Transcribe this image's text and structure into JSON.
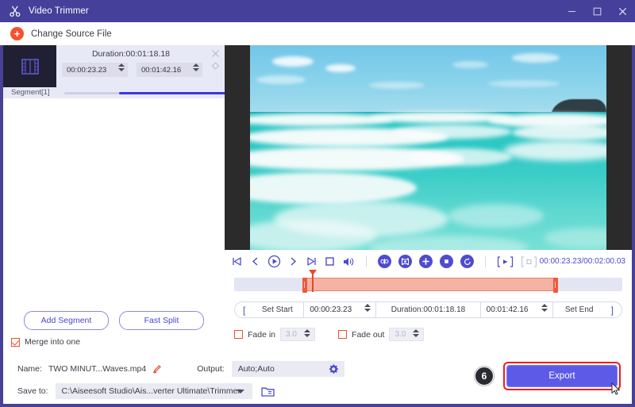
{
  "window": {
    "title": "Video Trimmer",
    "icon": "scissors-icon",
    "minimize": "minimize-icon",
    "maximize": "maximize-icon",
    "close": "close-icon"
  },
  "source_bar": {
    "add_icon": "plus-circle-icon",
    "label": "Change Source File"
  },
  "segment": {
    "thumb_icon": "film-strip-icon",
    "label": "Segment[1]",
    "duration_label": "Duration:00:01:18.18",
    "start_time": "00:00:23.23",
    "end_time": "00:01:42.16",
    "close_icon": "close-icon",
    "collapse_icon": "diamond-expand-icon",
    "progress_percent": 62
  },
  "left_actions": {
    "add_segment": "Add Segment",
    "fast_split": "Fast Split",
    "merge_label": "Merge into one",
    "merge_checked": true
  },
  "player": {
    "icons": [
      "skip-to-start-icon",
      "previous-frame-icon",
      "play-icon",
      "next-frame-icon",
      "skip-to-end-icon",
      "stop-icon",
      "volume-icon"
    ],
    "tools": [
      "split-clip-icon",
      "snapshot-icon",
      "add-clip-icon",
      "crop-icon",
      "reset-icon"
    ],
    "view_icons": [
      "preview-output-icon",
      "preview-original-icon"
    ],
    "timecode_current": "00:00:23.23",
    "timecode_total": "00:02:00.03",
    "timecode": "00:00:23.23/00:02:00.03"
  },
  "trim": {
    "bracket_left": "[",
    "bracket_right": "]",
    "set_start": "Set Start",
    "set_end": "Set End",
    "start_value": "00:00:23.23",
    "end_value": "00:01:42.16",
    "duration": "Duration:00:01:18.18"
  },
  "fade": {
    "fade_in_label": "Fade in",
    "fade_in_value": "3.0",
    "fade_in_checked": false,
    "fade_out_label": "Fade out",
    "fade_out_value": "3.0",
    "fade_out_checked": false
  },
  "output": {
    "name_label": "Name:",
    "name_value": "TWO MINUT...Waves.mp4",
    "edit_icon": "pencil-icon",
    "output_label": "Output:",
    "output_value": "Auto;Auto",
    "settings_icon": "gear-icon",
    "saveto_label": "Save to:",
    "saveto_value": "C:\\Aiseesoft Studio\\Ais...verter Ultimate\\Trimmer",
    "dropdown_icon": "chevron-down-icon",
    "folder_icon": "open-folder-icon"
  },
  "export": {
    "step_badge": "6",
    "label": "Export"
  },
  "colors": {
    "accent_purple": "#5e5ae8",
    "title_bar": "#45409a",
    "orange": "#f4522e",
    "trim_region": "#f5b3a6",
    "highlight_red": "#f21b1b"
  }
}
